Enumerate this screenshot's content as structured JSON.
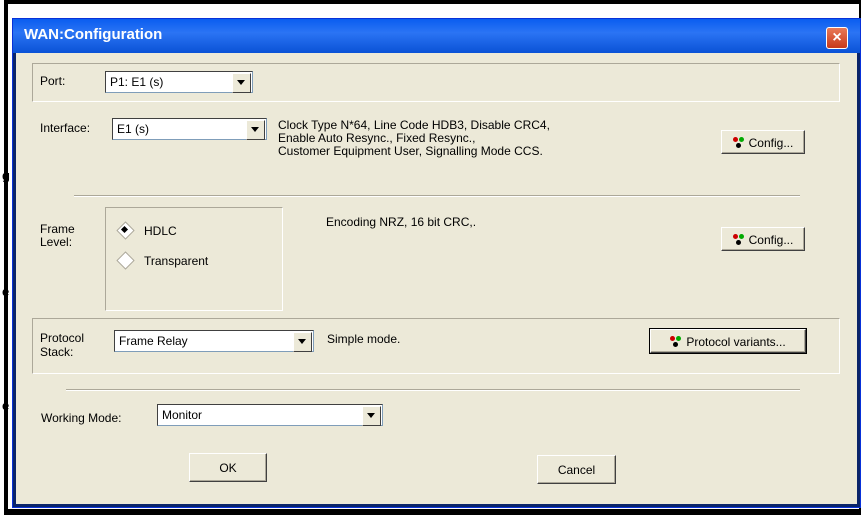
{
  "window": {
    "title": "WAN:Configuration",
    "close_label": "×"
  },
  "background_chars": [
    "g",
    "e",
    "e"
  ],
  "port": {
    "label": "Port:",
    "value": "P1: E1 (s)"
  },
  "interface": {
    "label": "Interface:",
    "value": "E1 (s)",
    "description": [
      "Clock Type N*64, Line Code HDB3, Disable CRC4,",
      "Enable Auto Resync., Fixed Resync.,",
      "Customer Equipment User, Signalling Mode CCS."
    ],
    "config_label": "Config..."
  },
  "frame_level": {
    "label_line1": "Frame",
    "label_line2": "Level:",
    "options": [
      "HDLC",
      "Transparent"
    ],
    "selected": "HDLC",
    "description": "Encoding NRZ,  16 bit CRC,.",
    "config_label": "Config..."
  },
  "protocol_stack": {
    "label_line1": "Protocol",
    "label_line2": "Stack:",
    "value": "Frame Relay",
    "description": "Simple mode.",
    "variants_label": "Protocol variants..."
  },
  "working_mode": {
    "label": "Working Mode:",
    "value": "Monitor"
  },
  "buttons": {
    "ok": "OK",
    "cancel": "Cancel"
  },
  "colors": {
    "titlebar": "#0a5df0",
    "client": "#ece9d8",
    "close": "#c8391a"
  }
}
